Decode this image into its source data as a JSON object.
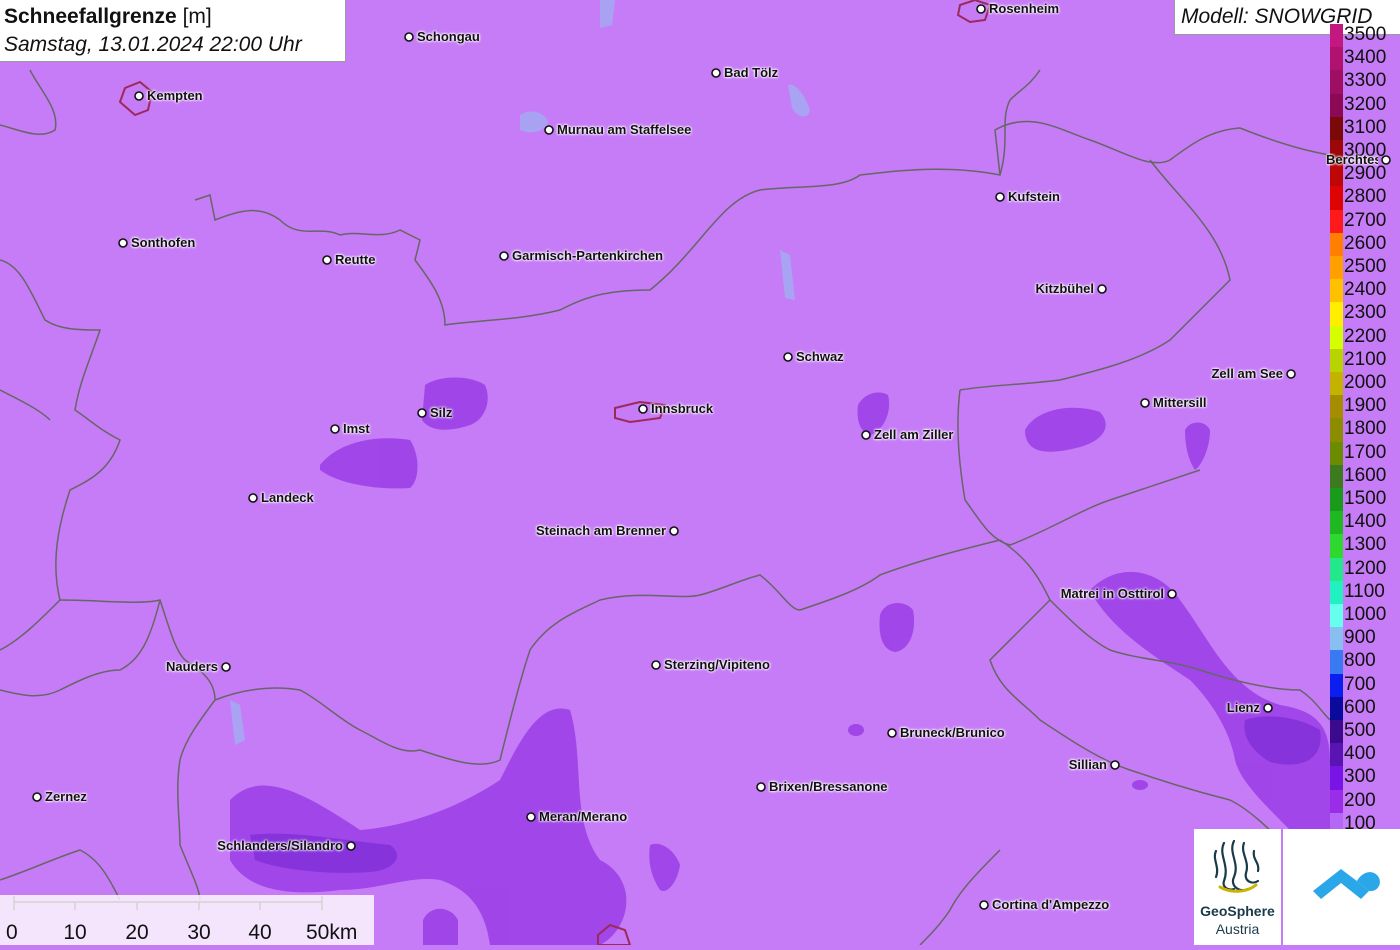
{
  "title": {
    "main": "Schneefallgrenze",
    "unit": "[m]",
    "datetime": "Samstag, 13.01.2024 22:00 Uhr"
  },
  "model": "Modell: SNOWGRID",
  "legend": [
    {
      "label": "3500",
      "color": "#c2187f"
    },
    {
      "label": "3400",
      "color": "#b0126f"
    },
    {
      "label": "3300",
      "color": "#9e0e62"
    },
    {
      "label": "3200",
      "color": "#8c0a55"
    },
    {
      "label": "3100",
      "color": "#7a0a0a"
    },
    {
      "label": "3000",
      "color": "#9c0808"
    },
    {
      "label": "2900",
      "color": "#bd0606"
    },
    {
      "label": "2800",
      "color": "#df0404"
    },
    {
      "label": "2700",
      "color": "#ff1a1a"
    },
    {
      "label": "2600",
      "color": "#ff8000"
    },
    {
      "label": "2500",
      "color": "#ff9f00"
    },
    {
      "label": "2400",
      "color": "#ffc000"
    },
    {
      "label": "2300",
      "color": "#ffee00"
    },
    {
      "label": "2200",
      "color": "#d4ff00"
    },
    {
      "label": "2100",
      "color": "#b8d400"
    },
    {
      "label": "2000",
      "color": "#c3b300"
    },
    {
      "label": "1900",
      "color": "#a68c00"
    },
    {
      "label": "1800",
      "color": "#8c8c00"
    },
    {
      "label": "1700",
      "color": "#6b8c00"
    },
    {
      "label": "1600",
      "color": "#3c7a1e"
    },
    {
      "label": "1500",
      "color": "#1a9a1a"
    },
    {
      "label": "1400",
      "color": "#20b820"
    },
    {
      "label": "1300",
      "color": "#2ed82e"
    },
    {
      "label": "1200",
      "color": "#22e88a"
    },
    {
      "label": "1100",
      "color": "#22f0c0"
    },
    {
      "label": "1000",
      "color": "#66ffee"
    },
    {
      "label": "900",
      "color": "#88bff0"
    },
    {
      "label": "800",
      "color": "#3a7af0"
    },
    {
      "label": "700",
      "color": "#0a1ef0"
    },
    {
      "label": "600",
      "color": "#0a0a9c"
    },
    {
      "label": "500",
      "color": "#3c0a8c"
    },
    {
      "label": "400",
      "color": "#5a14b4"
    },
    {
      "label": "300",
      "color": "#7814e6"
    },
    {
      "label": "200",
      "color": "#9a2ee8"
    },
    {
      "label": "100",
      "color": "#b568f5"
    }
  ],
  "cities": [
    {
      "name": "Schongau"
    },
    {
      "name": "Rosenheim"
    },
    {
      "name": "Kempten"
    },
    {
      "name": "Bad Tölz"
    },
    {
      "name": "Murnau am Staffelsee"
    },
    {
      "name": "Berchtesgaden"
    },
    {
      "name": "Kufstein"
    },
    {
      "name": "Sonthofen"
    },
    {
      "name": "Reutte"
    },
    {
      "name": "Garmisch-Partenkirchen"
    },
    {
      "name": "Kitzbühel"
    },
    {
      "name": "Schwaz"
    },
    {
      "name": "Zell am See"
    },
    {
      "name": "Silz"
    },
    {
      "name": "Innsbruck"
    },
    {
      "name": "Mittersill"
    },
    {
      "name": "Imst"
    },
    {
      "name": "Zell am Ziller"
    },
    {
      "name": "Landeck"
    },
    {
      "name": "Steinach am Brenner"
    },
    {
      "name": "Matrei in Osttirol"
    },
    {
      "name": "Nauders"
    },
    {
      "name": "Sterzing/Vipiteno"
    },
    {
      "name": "Lienz"
    },
    {
      "name": "Bruneck/Brunico"
    },
    {
      "name": "Sillian"
    },
    {
      "name": "Brixen/Bressanone"
    },
    {
      "name": "Zernez"
    },
    {
      "name": "Meran/Merano"
    },
    {
      "name": "Schlanders/Silandro"
    },
    {
      "name": "Cortina d'Ampezzo"
    }
  ],
  "scale": {
    "labels": [
      "0",
      "10",
      "20",
      "30",
      "40",
      "50km"
    ]
  },
  "logos": {
    "geosphere_line1": "GeoSphere",
    "geosphere_line2": "Austria"
  }
}
